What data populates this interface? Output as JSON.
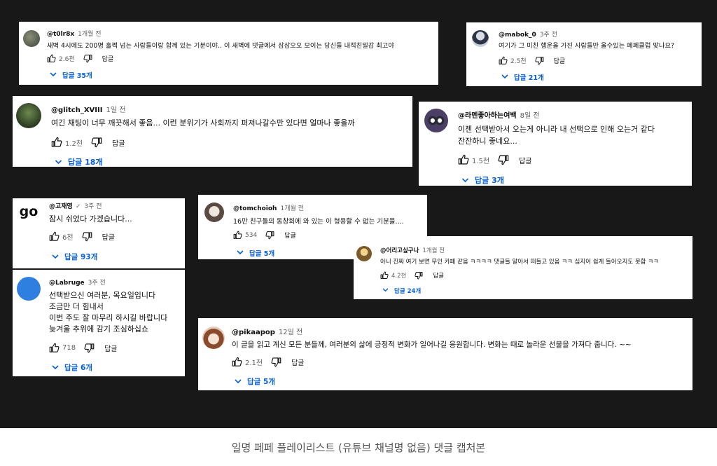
{
  "caption": "일명 페페 플레이리스트 (유튜브 채널명 없음) 댓글 캡처본",
  "reply_label": "답글",
  "colors": {
    "background": "#181818",
    "card": "#ffffff",
    "link": "#065fd4",
    "meta": "#606060"
  },
  "comments": [
    {
      "user": "@t0lr8x",
      "time": "1개월 전",
      "text": [
        "새벽 4시에도 200명 훌쩍 넘는 사람들이랑 함께 있는 기분이야.. 이 새벽에 댓글에서 삼삼오오 모이는 당신들 내적친밀감 최고야"
      ],
      "likes": "2.6천",
      "replies": "답글 35개",
      "avatar": "avatar-dark-landscape"
    },
    {
      "user": "@mabok_0",
      "time": "3주 전",
      "text": [
        "여기가 그 미친 행운을 가진 사람들만 올수있는 페페클럽 맞나요?"
      ],
      "likes": "2.5천",
      "replies": "답글 21개",
      "avatar": "avatar-character"
    },
    {
      "user": "@glitch_XVIII",
      "time": "1일 전",
      "text": [
        "여긴 채팅이 너무 깨끗해서 좋음... 이런 분위기가 사회까지 퍼져나갈수만 있다면 얼마나 좋을까"
      ],
      "likes": "1.2천",
      "replies": "답글 18개",
      "avatar": "avatar-green-landscape"
    },
    {
      "user": "@라멘좋아하는여백",
      "time": "8일 전",
      "text": [
        "이젠 선택받아서 오는게 아니라 내 선택으로 인해 오는거 같다",
        "잔잔하니 좋네요..."
      ],
      "likes": "1.5천",
      "replies": "답글 3개",
      "avatar": "avatar-cartoon-face"
    },
    {
      "user": "@고재영",
      "verified": "✓",
      "time": "3주 전",
      "text": [
        "잠시 쉬었다 가겠습니다..."
      ],
      "likes": "6천",
      "replies": "답글 93개",
      "avatar_text": "go"
    },
    {
      "user": "@tomchoioh",
      "time": "1개월 전",
      "text": [
        "16만 친구들의 동창회에 와 있는 이 형용할 수 없는 기분을...."
      ],
      "likes": "534",
      "replies": "답글 5개",
      "avatar": "avatar-photo"
    },
    {
      "user": "@어리고싶구나",
      "time": "1개월 전",
      "text": [
        "아니 진짜 여기 보면 무인 카페 같음 ㅋㅋㅋㅋ 댓글들 알아서 떠들고 있음 ㅋㅋ 심지어 쉽게 들어오지도 못함 ㅋㅋ"
      ],
      "likes": "4.2천",
      "replies": "답글 24개",
      "avatar": "avatar-anime"
    },
    {
      "user": "@Labruge",
      "time": "3주 전",
      "text": [
        "선택받으신 여러분, 목요일입니다",
        "조금만 더 힘내서",
        "이번 주도 잘 마무리 하시길 바랍니다",
        "늦겨울 추위에 감기 조심하십쇼"
      ],
      "likes": "718",
      "replies": "답글 6개",
      "avatar": "avatar-blue-circle"
    },
    {
      "user": "@pikaapop",
      "time": "12일 전",
      "text": [
        "이 글을 읽고 계신 모든 분들께, 여러분의 삶에 긍정적 변화가 일어나길 응원합니다. 변화는 때로 놀라운 선물을 가져다 줍니다.  ~~"
      ],
      "likes": "2.1천",
      "replies": "답글 5개",
      "avatar": "avatar-anime-girl"
    }
  ]
}
